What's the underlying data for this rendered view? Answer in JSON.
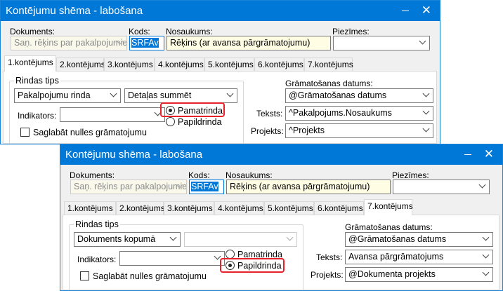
{
  "windows": [
    {
      "title": "Kontējumu shēma - labošana",
      "labels": {
        "dokuments": "Dokuments:",
        "kods": "Kods:",
        "nosaukums": "Nosaukums:",
        "piezimes": "Piezīmes:"
      },
      "fields": {
        "dokuments": "Saņ. rēķins par pakalpojumiem",
        "kods": "SRFAv",
        "nosaukums": "Rēķins (ar avansa pārgrāmatojumu)",
        "piezimes": ""
      },
      "tabs": [
        "1.kontējums",
        "2.kontējums",
        "3.kontējums",
        "4.kontējums",
        "5.kontējums",
        "6.kontējums",
        "7.kontējums"
      ],
      "active_tab": "1.kontējums",
      "rindas_tips": {
        "label": "Rindas tips",
        "type": "Pakalpojumu rinda",
        "detail": "Detaļas summēt",
        "indikators_label": "Indikators:",
        "indikators": "",
        "radio_main": "Pamatrinda",
        "radio_extra": "Papildrinda",
        "selected": "Pamatrinda",
        "checkbox": "Saglabāt nulles grāmatojumu",
        "checkbox_checked": false
      },
      "right": {
        "datums_label": "Grāmatošanas datums:",
        "datums": "@Grāmatošanas datums",
        "teksts_label": "Teksts:",
        "teksts": "^Pakalpojums.Nosaukums",
        "projekts_label": "Projekts:",
        "projekts": "^Projekts"
      }
    },
    {
      "title": "Kontējumu shēma - labošana",
      "labels": {
        "dokuments": "Dokuments:",
        "kods": "Kods:",
        "nosaukums": "Nosaukums:",
        "piezimes": "Piezīmes:"
      },
      "fields": {
        "dokuments": "Saņ. rēķins par pakalpojumiem",
        "kods": "SRFAv",
        "nosaukums": "Rēķins (ar avansa pārgrāmatojumu)",
        "piezimes": ""
      },
      "tabs": [
        "1.kontējums",
        "2.kontējums",
        "3.kontējums",
        "4.kontējums",
        "5.kontējums",
        "6.kontējums",
        "7.kontējums"
      ],
      "active_tab": "7.kontējums",
      "rindas_tips": {
        "label": "Rindas tips",
        "type": "Dokuments kopumā",
        "detail": "",
        "indikators_label": "Indikators:",
        "indikators": "",
        "radio_main": "Pamatrinda",
        "radio_extra": "Papildrinda",
        "selected": "Papildrinda",
        "checkbox": "Saglabāt nulles grāmatojumu",
        "checkbox_checked": false
      },
      "right": {
        "datums_label": "Grāmatošanas datums:",
        "datums": "@Grāmatošanas datums",
        "teksts_label": "Teksts:",
        "teksts": "Avansa pārgrāmatojums",
        "projekts_label": "Projekts:",
        "projekts": "@Dokumenta projekts"
      }
    }
  ],
  "colors": {
    "titlebar": "#0078d7",
    "highlight": "#e8202a"
  }
}
